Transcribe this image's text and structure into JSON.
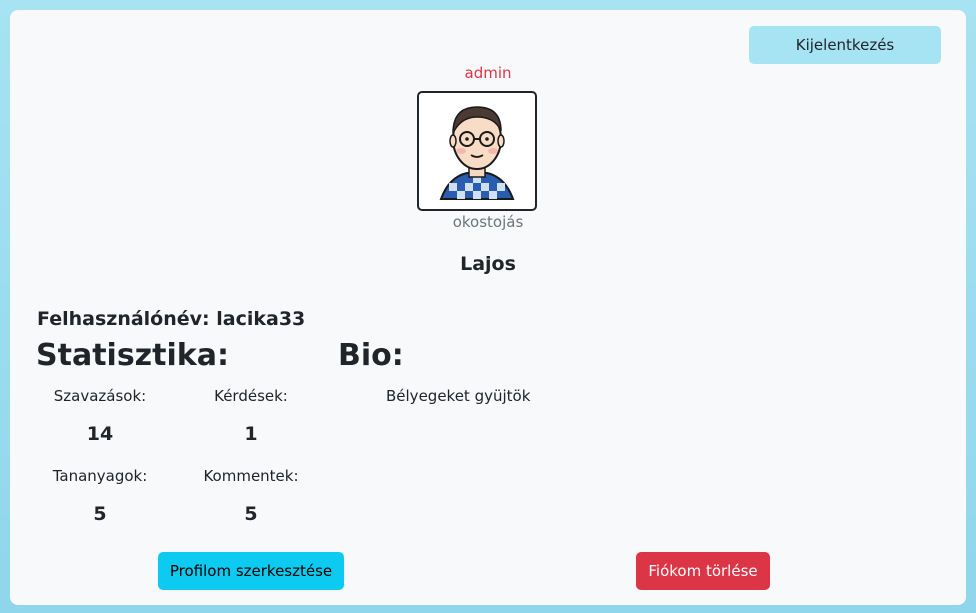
{
  "header": {
    "logout_label": "Kijelentkezés"
  },
  "profile": {
    "role": "admin",
    "rank": "okostojás",
    "display_name": "Lajos",
    "username_label": "Felhasználónév:",
    "username": "lacika33"
  },
  "stats": {
    "title": "Statisztika:",
    "items": [
      {
        "label": "Szavazások:",
        "value": "14"
      },
      {
        "label": "Kérdések:",
        "value": "1"
      },
      {
        "label": "Tananyagok:",
        "value": "5"
      },
      {
        "label": "Kommentek:",
        "value": "5"
      }
    ]
  },
  "bio": {
    "title": "Bio:",
    "text": "Bélyegeket gyüjtök"
  },
  "actions": {
    "edit_label": "Profilom szerkesztése",
    "delete_label": "Fiókom törlése"
  },
  "colors": {
    "accent": "#0dcaf0",
    "danger": "#dc3545",
    "light_accent": "#a6e3f3"
  }
}
